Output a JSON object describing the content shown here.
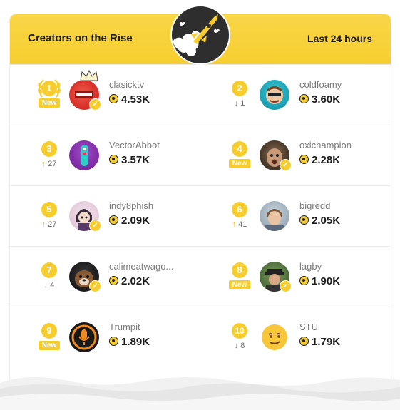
{
  "header": {
    "title": "Creators on the Rise",
    "period": "Last 24 hours"
  },
  "colors": {
    "accent": "#f7cd2e",
    "header_bg": "#f6ce2f",
    "text_dark": "#1d1d1d",
    "text_muted": "#7a7a7a"
  },
  "icons": {
    "badge": "rocket-launch-icon",
    "coin": "coin-icon",
    "verified": "verified-check-icon",
    "up": "arrow-up-icon",
    "down": "arrow-down-icon"
  },
  "creators": [
    {
      "rank": "1",
      "username": "clasicktv",
      "score": "4.53K",
      "change": "",
      "direction": "",
      "is_new": true,
      "verified": true,
      "crown": true,
      "laurel": true,
      "new_label": "New"
    },
    {
      "rank": "2",
      "username": "coldfoamy",
      "score": "3.60K",
      "change": "1",
      "direction": "down",
      "is_new": false,
      "verified": false
    },
    {
      "rank": "3",
      "username": "VectorAbbot",
      "score": "3.57K",
      "change": "27",
      "direction": "up",
      "is_new": false,
      "verified": false
    },
    {
      "rank": "4",
      "username": "oxichampion",
      "score": "2.28K",
      "change": "",
      "direction": "",
      "is_new": true,
      "verified": true,
      "new_label": "New"
    },
    {
      "rank": "5",
      "username": "indy8phish",
      "score": "2.09K",
      "change": "27",
      "direction": "up",
      "is_new": false,
      "verified": true
    },
    {
      "rank": "6",
      "username": "bigredd",
      "score": "2.05K",
      "change": "41",
      "direction": "up",
      "is_new": false,
      "verified": false
    },
    {
      "rank": "7",
      "username": "calimeatwago...",
      "score": "2.02K",
      "change": "4",
      "direction": "down",
      "is_new": false,
      "verified": true
    },
    {
      "rank": "8",
      "username": "lagby",
      "score": "1.90K",
      "change": "",
      "direction": "",
      "is_new": true,
      "verified": true,
      "new_label": "New"
    },
    {
      "rank": "9",
      "username": "Trumpit",
      "score": "1.89K",
      "change": "",
      "direction": "",
      "is_new": true,
      "verified": false,
      "new_label": "New"
    },
    {
      "rank": "10",
      "username": "STU",
      "score": "1.79K",
      "change": "8",
      "direction": "down",
      "is_new": false,
      "verified": false
    }
  ]
}
